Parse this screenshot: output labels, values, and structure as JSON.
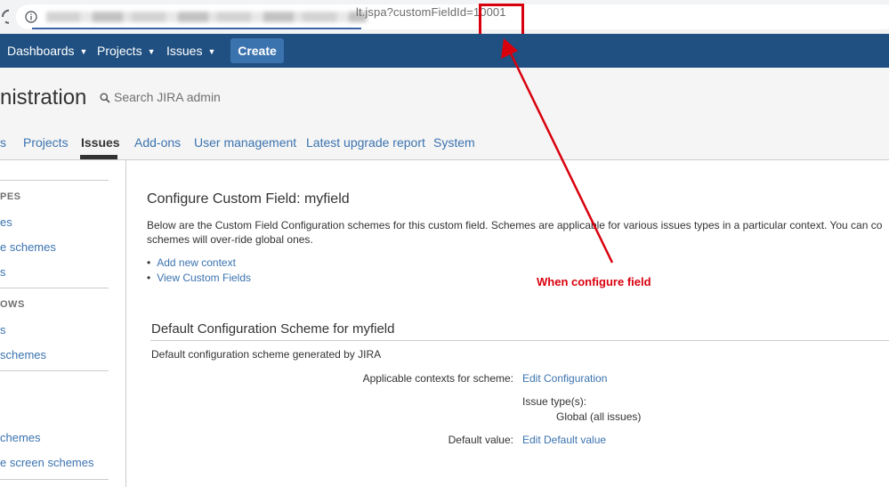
{
  "browser": {
    "url_suffix": "lt.jspa?customFieldId=",
    "url_id": "10001",
    "colors": {
      "highlight": "#d9000d"
    }
  },
  "header": {
    "nav": [
      {
        "label": "Dashboards"
      },
      {
        "label": "Projects"
      },
      {
        "label": "Issues"
      }
    ],
    "create_label": "Create",
    "colors": {
      "background": "#205081",
      "create": "#3b73af"
    }
  },
  "admin": {
    "title": "nistration",
    "search_label": "Search JIRA admin",
    "tabs": [
      {
        "label": "s"
      },
      {
        "label": "Projects"
      },
      {
        "label": "Issues"
      },
      {
        "label": "Add-ons"
      },
      {
        "label": "User management"
      },
      {
        "label": "Latest upgrade report"
      },
      {
        "label": "System"
      }
    ],
    "active_tab": "Issues"
  },
  "sidebar": {
    "sections": [
      {
        "heading": "PES",
        "items": [
          "es",
          "e schemes",
          "s"
        ]
      },
      {
        "heading": "OWS",
        "items": [
          "s",
          " schemes"
        ]
      },
      {
        "heading": "",
        "items": [
          "chemes",
          "e screen schemes"
        ]
      }
    ]
  },
  "main": {
    "heading": "Configure Custom Field: myfield",
    "description_line1": "Below are the Custom Field Configuration schemes for this custom field. Schemes are applicable for various issues types in a particular context. You can co",
    "description_line2": "schemes will over-ride global ones.",
    "links": [
      "Add new context",
      "View Custom Fields"
    ],
    "annotation": "When configure field",
    "scheme": {
      "heading": "Default Configuration Scheme for myfield",
      "description": "Default configuration scheme generated by JIRA",
      "contexts_label": "Applicable contexts for scheme:",
      "edit_configuration": "Edit Configuration",
      "issue_types_label": "Issue type(s):",
      "issue_types_value": "Global (all issues)",
      "default_value_label": "Default value:",
      "edit_default_value": "Edit Default value"
    }
  }
}
